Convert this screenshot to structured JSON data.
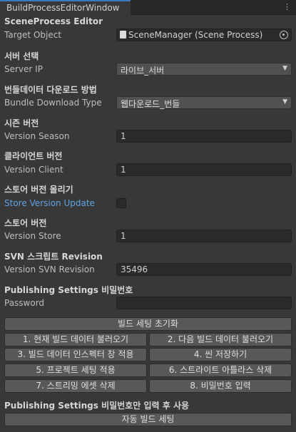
{
  "window": {
    "tab_title": "BuildProcessEditorWindow",
    "menu_glyph": "⋮"
  },
  "scene_process": {
    "header": "SceneProcess Editor",
    "target_label": "Target Object",
    "target_value": "SceneManager (Scene Process)"
  },
  "server": {
    "header": "서버 선택",
    "label": "Server IP",
    "value": "라이브_서버"
  },
  "bundle": {
    "header": "번들데이터 다운로드 방법",
    "label": "Bundle Download Type",
    "value": "웹다운로드_번들"
  },
  "season": {
    "header": "시즌 버전",
    "label": "Version Season",
    "value": "1"
  },
  "client": {
    "header": "클라이언트 버전",
    "label": "Version Client",
    "value": "1"
  },
  "store_update": {
    "header": "스토어 버전 올리기",
    "label": "Store Version Update",
    "checked": false
  },
  "store": {
    "header": "스토어 버전",
    "label": "Version Store",
    "value": "1"
  },
  "svn": {
    "header": "SVN 스크립트 Revision",
    "label": "Version SVN Revision",
    "value": "35496"
  },
  "publishing": {
    "header": "Publishing Settings 비밀번호",
    "label": "Password",
    "value": ""
  },
  "buttons": {
    "reset": "빌드 세팅 초기화",
    "b1": "1. 현재 빌드 데이터 불러오기",
    "b2": "2. 다음 빌드 데이터 불러오기",
    "b3": "3. 빌드 데이터 인스펙터 창 적용",
    "b4": "4. 씬 저장하기",
    "b5": "5. 프로젝트 세팅 적용",
    "b6": "6. 스트라이트 아틀라스 삭제",
    "b7": "7. 스트리밍 에셋 삭제",
    "b8": "8. 비밀번호 입력"
  },
  "auto": {
    "header": "Publishing Settings 비밀번호만 입력 후 사용",
    "button": "자동 빌드 세팅"
  }
}
